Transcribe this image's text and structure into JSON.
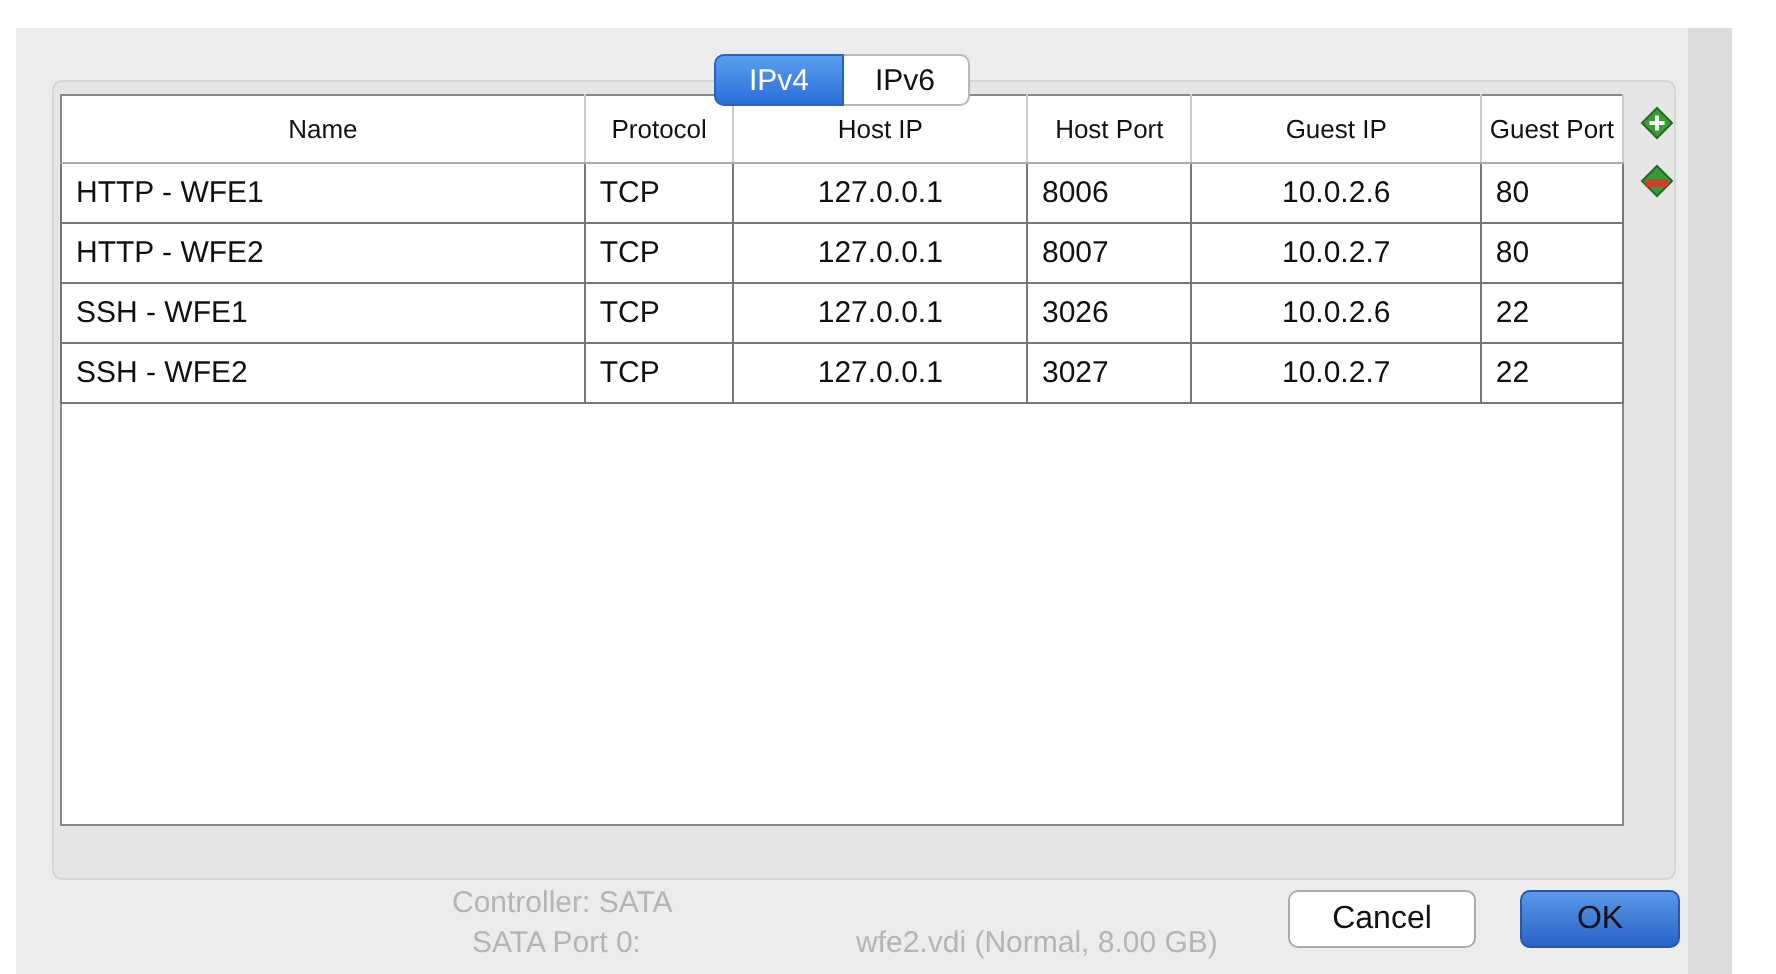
{
  "tabs": [
    {
      "label": "IPv4",
      "selected": true
    },
    {
      "label": "IPv6",
      "selected": false
    }
  ],
  "table": {
    "columns": [
      "Name",
      "Protocol",
      "Host IP",
      "Host Port",
      "Guest IP",
      "Guest Port"
    ],
    "rows": [
      [
        "HTTP - WFE1",
        "TCP",
        "127.0.0.1",
        "8006",
        "10.0.2.6",
        "80"
      ],
      [
        "HTTP - WFE2",
        "TCP",
        "127.0.0.1",
        "8007",
        "10.0.2.7",
        "80"
      ],
      [
        "SSH - WFE1",
        "TCP",
        "127.0.0.1",
        "3026",
        "10.0.2.6",
        "22"
      ],
      [
        "SSH - WFE2",
        "TCP",
        "127.0.0.1",
        "3027",
        "10.0.2.7",
        "22"
      ]
    ]
  },
  "background_details": [
    {
      "label": "Controller: SATA"
    },
    {
      "label": "SATA Port 0:",
      "value": "wfe2.vdi (Normal, 8.00 GB)"
    }
  ],
  "buttons": [
    {
      "label": "Cancel",
      "kind": "normal"
    },
    {
      "label": "OK",
      "kind": "default"
    }
  ]
}
